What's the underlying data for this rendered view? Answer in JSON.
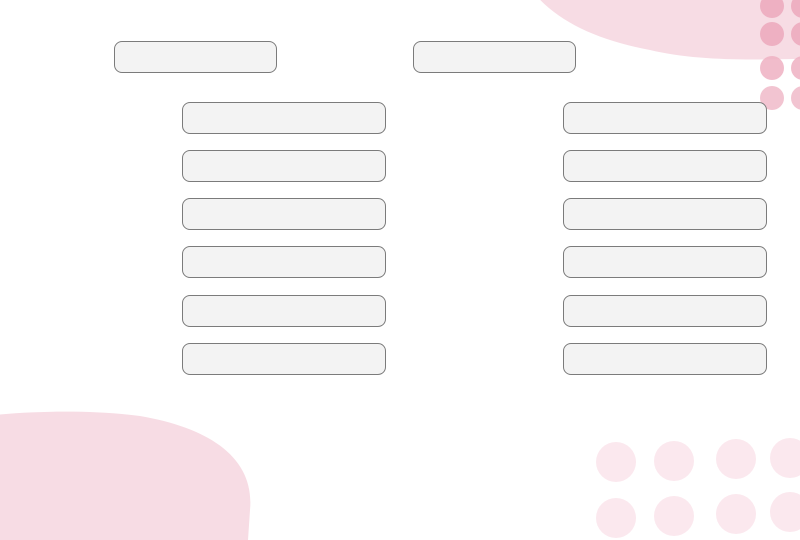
{
  "theme": {
    "blob_color": "#f7dce4",
    "dot_strong_color": "#eeb0c2",
    "dot_soft_color": "#fbe8ee",
    "field_background": "#f3f3f3",
    "field_border": "#7b7b7b"
  },
  "form": {
    "header_fields": [
      {
        "value": "",
        "placeholder": ""
      },
      {
        "value": "",
        "placeholder": ""
      }
    ],
    "left_column": [
      {
        "value": "",
        "placeholder": ""
      },
      {
        "value": "",
        "placeholder": ""
      },
      {
        "value": "",
        "placeholder": ""
      },
      {
        "value": "",
        "placeholder": ""
      },
      {
        "value": "",
        "placeholder": ""
      },
      {
        "value": "",
        "placeholder": ""
      }
    ],
    "right_column": [
      {
        "value": "",
        "placeholder": ""
      },
      {
        "value": "",
        "placeholder": ""
      },
      {
        "value": "",
        "placeholder": ""
      },
      {
        "value": "",
        "placeholder": ""
      },
      {
        "value": "",
        "placeholder": ""
      },
      {
        "value": "",
        "placeholder": ""
      }
    ]
  }
}
